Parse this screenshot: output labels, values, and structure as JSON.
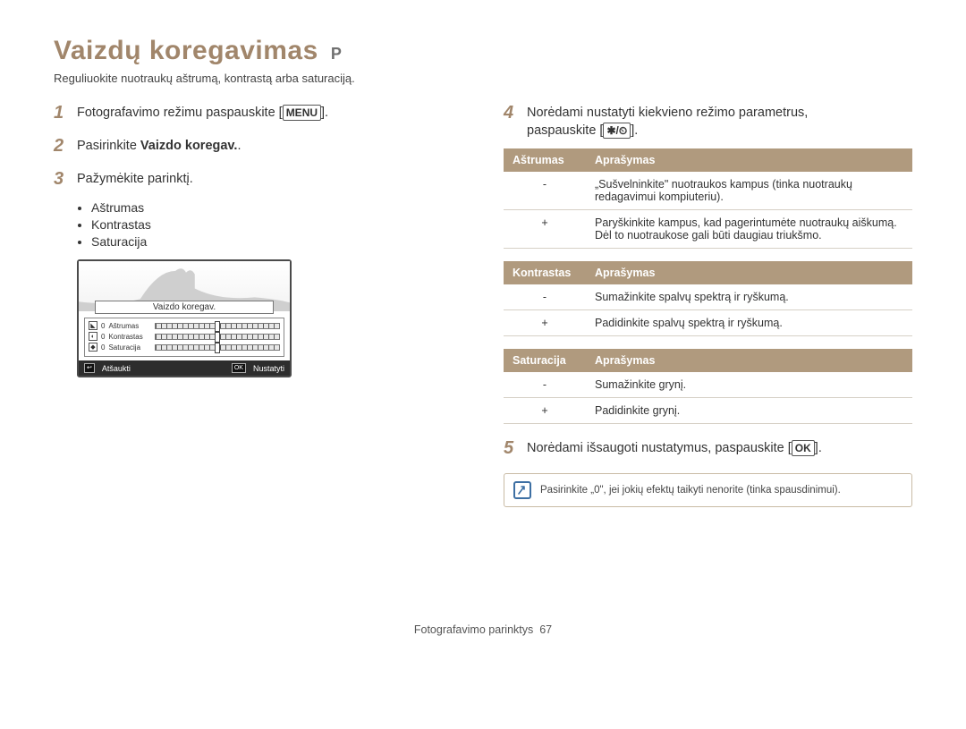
{
  "header": {
    "title": "Vaizdų koregavimas",
    "mode": "P",
    "subtitle": "Reguliuokite nuotraukų aštrumą, kontrastą arba saturaciją."
  },
  "left": {
    "step1": {
      "num": "1",
      "prefix": "Fotografavimo režimu paspauskite [",
      "kbd": "MENU",
      "suffix": "]."
    },
    "step2": {
      "num": "2",
      "prefix": "Pasirinkite ",
      "bold": "Vaizdo koregav.",
      "suffix": "."
    },
    "step3": {
      "num": "3",
      "text": "Pažymėkite parinktį."
    },
    "options": [
      "Aštrumas",
      "Kontrastas",
      "Saturacija"
    ],
    "lcd": {
      "title": "Vaizdo koregav.",
      "rows": [
        {
          "icon": "◣",
          "val": "0",
          "label": "Aštrumas"
        },
        {
          "icon": "◐",
          "val": "0",
          "label": "Kontrastas"
        },
        {
          "icon": "◆",
          "val": "0",
          "label": "Saturacija"
        }
      ],
      "cancel_icon": "↩",
      "cancel": "Atšaukti",
      "set_icon": "OK",
      "set": "Nustatyti"
    }
  },
  "right": {
    "step4": {
      "num": "4",
      "line1": "Norėdami nustatyti kiekvieno režimo parametrus,",
      "line2_prefix": "paspauskite [",
      "kbd": "✱/⏲",
      "line2_suffix": "]."
    },
    "tables": {
      "sharpness": {
        "col1": "Aštrumas",
        "col2": "Aprašymas",
        "rows": [
          {
            "k": "-",
            "v": "„Sušvelninkite\" nuotraukos kampus (tinka nuotraukų redagavimui kompiuteriu)."
          },
          {
            "k": "+",
            "v": "Paryškinkite kampus, kad pagerintumėte nuotraukų aiškumą. Dėl to nuotraukose gali būti daugiau triukšmo."
          }
        ]
      },
      "contrast": {
        "col1": "Kontrastas",
        "col2": "Aprašymas",
        "rows": [
          {
            "k": "-",
            "v": "Sumažinkite spalvų spektrą ir ryškumą."
          },
          {
            "k": "+",
            "v": "Padidinkite spalvų spektrą ir ryškumą."
          }
        ]
      },
      "saturation": {
        "col1": "Saturacija",
        "col2": "Aprašymas",
        "rows": [
          {
            "k": "-",
            "v": "Sumažinkite grynį."
          },
          {
            "k": "+",
            "v": "Padidinkite grynį."
          }
        ]
      }
    },
    "step5": {
      "num": "5",
      "prefix": "Norėdami išsaugoti nustatymus, paspauskite [",
      "kbd": "OK",
      "suffix": "]."
    },
    "note": "Pasirinkite „0\", jei jokių efektų taikyti nenorite (tinka spausdinimui)."
  },
  "footer": {
    "section": "Fotografavimo parinktys",
    "page": "67"
  }
}
